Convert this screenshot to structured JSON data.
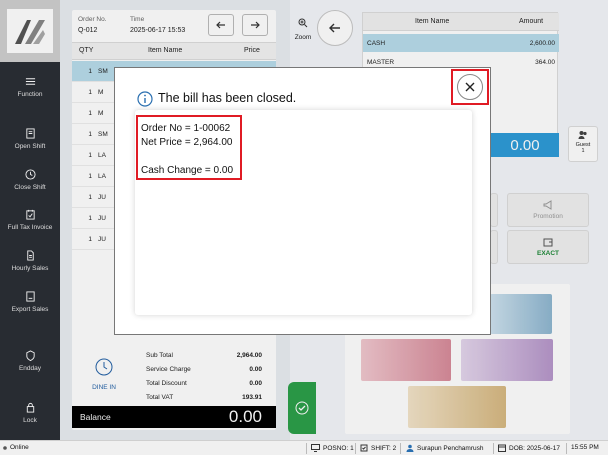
{
  "sidebar": {
    "items": [
      {
        "label": "Function",
        "icon": "menu-icon"
      },
      {
        "label": "Open Shift",
        "icon": "open-shift-icon"
      },
      {
        "label": "Close Shift",
        "icon": "clock-icon"
      },
      {
        "label": "Full Tax Invoice",
        "icon": "invoice-icon"
      },
      {
        "label": "Hourly Sales",
        "icon": "document-icon"
      },
      {
        "label": "Export Sales",
        "icon": "export-icon"
      },
      {
        "label": "Endday",
        "icon": "endday-icon"
      },
      {
        "label": "Lock",
        "icon": "lock-icon"
      }
    ]
  },
  "order": {
    "order_no_label": "Order No.",
    "order_no": "Q-012",
    "time_label": "Time",
    "time": "2025-06-17 15:53",
    "columns": {
      "qty": "QTY",
      "item": "Item Name",
      "price": "Price"
    },
    "rows": [
      {
        "qty": "1",
        "name": "SM"
      },
      {
        "qty": "1",
        "name": "M"
      },
      {
        "qty": "1",
        "name": "M"
      },
      {
        "qty": "1",
        "name": "SM"
      },
      {
        "qty": "1",
        "name": "LA"
      },
      {
        "qty": "1",
        "name": "LA"
      },
      {
        "qty": "1",
        "name": "JU"
      },
      {
        "qty": "1",
        "name": "JU"
      },
      {
        "qty": "1",
        "name": "JU"
      }
    ],
    "dine_in": "DINE IN",
    "summary": {
      "sub_total_label": "Sub Total",
      "sub_total": "2,964.00",
      "service_label": "Service Charge",
      "service": "0.00",
      "discount_label": "Total Discount",
      "discount": "0.00",
      "vat_label": "Total VAT",
      "vat": "193.91"
    },
    "balance_label": "Balance",
    "balance": "0.00"
  },
  "payment": {
    "zoom_label": "Zoom",
    "columns": {
      "item": "Item Name",
      "amount": "Amount"
    },
    "rows": [
      {
        "name": "CASH",
        "amount": "2,600.00"
      },
      {
        "name": "MASTER",
        "amount": "364.00"
      }
    ],
    "total": "0.00",
    "guest_label": "Guest",
    "guest_count": "1",
    "promotion_label": "Promotion",
    "exact_label": "EXACT"
  },
  "dialog": {
    "title": "The bill has been closed.",
    "order_line": "Order No = 1-00062",
    "net_line": "Net Price = 2,964.00",
    "change_line": "Cash Change = 0.00"
  },
  "statusbar": {
    "status": "Online",
    "posno": "POSNO: 1",
    "shift": "SHIFT: 2",
    "user": "Surapun Penchamrush",
    "dob": "DOB: 2025-06-17",
    "clock": "15:55 PM"
  },
  "colors": {
    "sidebar": "#2b2f36",
    "selection": "#b8dceb",
    "accent_blue": "#2e9cd8",
    "highlight_red": "#e01b24",
    "confirm_green": "#2ca04a",
    "exact_green": "#1f8a3a"
  }
}
